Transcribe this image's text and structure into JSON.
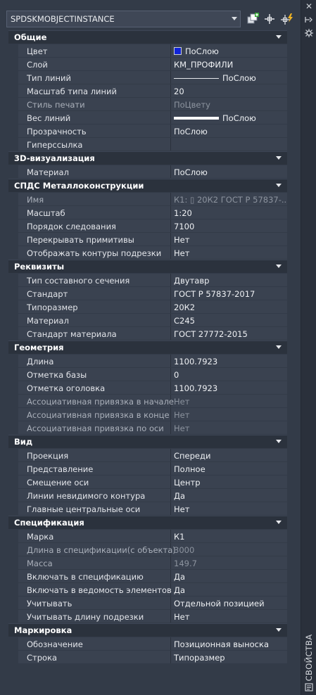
{
  "selector": {
    "value": "SPDSKMOBJECTINSTANCE"
  },
  "rail": {
    "title": "СВОЙСТВА"
  },
  "colors": {
    "swatch_blue": "#1024d8",
    "panel_bg": "#333b48"
  },
  "categories": [
    {
      "title": "Общие",
      "rows": [
        {
          "name": "Цвет",
          "value": "ПоСлою",
          "visual": "swatch"
        },
        {
          "name": "Слой",
          "value": "КМ_ПРОФИЛИ"
        },
        {
          "name": "Тип линий",
          "value": "ПоСлою",
          "visual": "linetype"
        },
        {
          "name": "Масштаб типа линий",
          "value": "20"
        },
        {
          "name": "Стиль печати",
          "value": "ПоЦвету",
          "dim": true
        },
        {
          "name": "Вес линий",
          "value": "ПоСлою",
          "visual": "lineweight"
        },
        {
          "name": "Прозрачность",
          "value": "ПоСлою"
        },
        {
          "name": "Гиперссылка",
          "value": ""
        }
      ]
    },
    {
      "title": "3D-визуализация",
      "rows": [
        {
          "name": "Материал",
          "value": "ПоСлою"
        }
      ]
    },
    {
      "title": "СПДС Металлоконструкции",
      "rows": [
        {
          "name": "Имя",
          "value": "К1: ▯ 20К2 ГОСТ Р 57837-...",
          "dim": true
        },
        {
          "name": "Масштаб",
          "value": "1:20"
        },
        {
          "name": "Порядок следования",
          "value": "7100"
        },
        {
          "name": "Перекрывать примитивы",
          "value": "Нет"
        },
        {
          "name": "Отображать контуры подрезки",
          "value": "Нет"
        }
      ]
    },
    {
      "title": "Реквизиты",
      "rows": [
        {
          "name": "Тип составного сечения",
          "value": "Двутавр"
        },
        {
          "name": "Стандарт",
          "value": "ГОСТ Р 57837-2017"
        },
        {
          "name": "Типоразмер",
          "value": "20К2"
        },
        {
          "name": "Материал",
          "value": "С245"
        },
        {
          "name": "Стандарт материала",
          "value": "ГОСТ 27772-2015"
        }
      ]
    },
    {
      "title": "Геометрия",
      "rows": [
        {
          "name": "Длина",
          "value": "1100.7923"
        },
        {
          "name": "Отметка базы",
          "value": "0"
        },
        {
          "name": "Отметка оголовка",
          "value": "1100.7923"
        },
        {
          "name": "Ассоциативная привязка в начале",
          "value": "Нет",
          "dim": true
        },
        {
          "name": "Ассоциативная привязка в конце",
          "value": "Нет",
          "dim": true
        },
        {
          "name": "Ассоциативная привязка по оси",
          "value": "Нет",
          "dim": true
        }
      ]
    },
    {
      "title": "Вид",
      "rows": [
        {
          "name": "Проекция",
          "value": "Спереди"
        },
        {
          "name": "Представление",
          "value": "Полное"
        },
        {
          "name": "Смещение оси",
          "value": "Центр"
        },
        {
          "name": "Линии невидимого контура",
          "value": "Да"
        },
        {
          "name": "Главные центральные оси",
          "value": "Нет"
        }
      ]
    },
    {
      "title": "Спецификация",
      "rows": [
        {
          "name": "Марка",
          "value": "К1"
        },
        {
          "name": "Длина в спецификации(с объекта)",
          "value": "3000",
          "dim": true
        },
        {
          "name": "Масса",
          "value": "149.7",
          "dim": true
        },
        {
          "name": "Включать в спецификацию",
          "value": "Да"
        },
        {
          "name": "Включать в ведомость элементов",
          "value": "Да"
        },
        {
          "name": "Учитывать",
          "value": "Отдельной позицией"
        },
        {
          "name": "Учитывать длину подрезки",
          "value": "Нет"
        }
      ]
    },
    {
      "title": "Маркировка",
      "rows": [
        {
          "name": "Обозначение",
          "value": "Позиционная выноска"
        },
        {
          "name": "Строка",
          "value": "Типоразмер"
        }
      ]
    }
  ]
}
